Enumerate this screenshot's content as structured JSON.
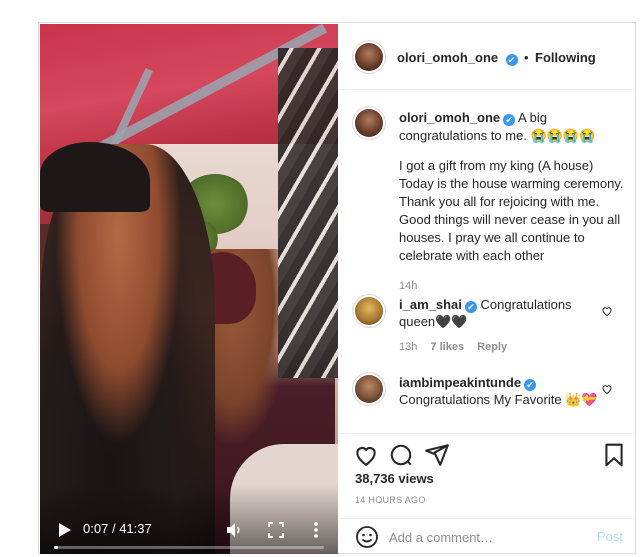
{
  "post": {
    "author": "olori_omoh_one",
    "verified_mark": "✔",
    "separator": "•",
    "follow_status": "Following"
  },
  "video": {
    "time_current": "0:07",
    "time_total": "41:37",
    "time_separator": "/",
    "progress_fraction": 0.003,
    "icons": [
      "play-icon",
      "volume-icon",
      "fullscreen-icon",
      "more-options-icon"
    ]
  },
  "caption": {
    "username": "olori_omoh_one",
    "headline": "A big congratulations to me. 😭😭😭😭",
    "body": "I got a gift from my king (A house)\nToday is the house warming ceremony. Thank you all for rejoicing with me. Good things will never cease in you all houses. I pray we all continue to celebrate with each other",
    "time": "14h"
  },
  "comments": [
    {
      "username": "i_am_shai",
      "verified": true,
      "text": "Congratulations queen🖤🖤",
      "time": "13h",
      "likes": "7 likes",
      "reply": "Reply"
    },
    {
      "username": "iambimpeakintunde",
      "verified": true,
      "text": "Congratulations My Favorite 👑💝"
    }
  ],
  "actions": {
    "views": "38,736 views",
    "posted_ago": "14 HOURS AGO",
    "icons": [
      "heart-icon",
      "comment-icon",
      "share-icon",
      "bookmark-icon"
    ]
  },
  "add_comment": {
    "placeholder": "Add a comment…",
    "post_label": "Post",
    "emoji_icon": "emoji-icon"
  },
  "colors": {
    "verified_blue": "#3897f0",
    "post_button_disabled": "#b2dffc",
    "muted_text": "#8e8e8e"
  }
}
